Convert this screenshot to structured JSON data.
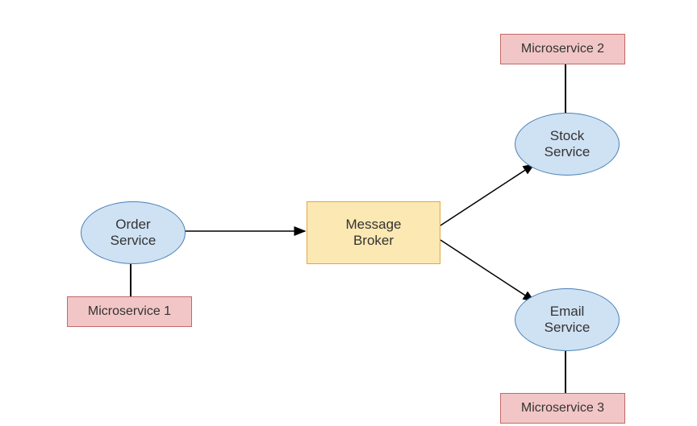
{
  "nodes": {
    "order_service": {
      "label": "Order\nService"
    },
    "message_broker": {
      "label": "Message\nBroker"
    },
    "stock_service": {
      "label": "Stock\nService"
    },
    "email_service": {
      "label": "Email\nService"
    },
    "microservice1": {
      "label": "Microservice 1"
    },
    "microservice2": {
      "label": "Microservice 2"
    },
    "microservice3": {
      "label": "Microservice 3"
    }
  },
  "colors": {
    "ellipse_fill": "#cfe2f3",
    "ellipse_stroke": "#4a80b8",
    "broker_fill": "#fce8b2",
    "broker_stroke": "#e4a83a",
    "ms_fill": "#f2c6c6",
    "ms_stroke": "#c46868"
  }
}
